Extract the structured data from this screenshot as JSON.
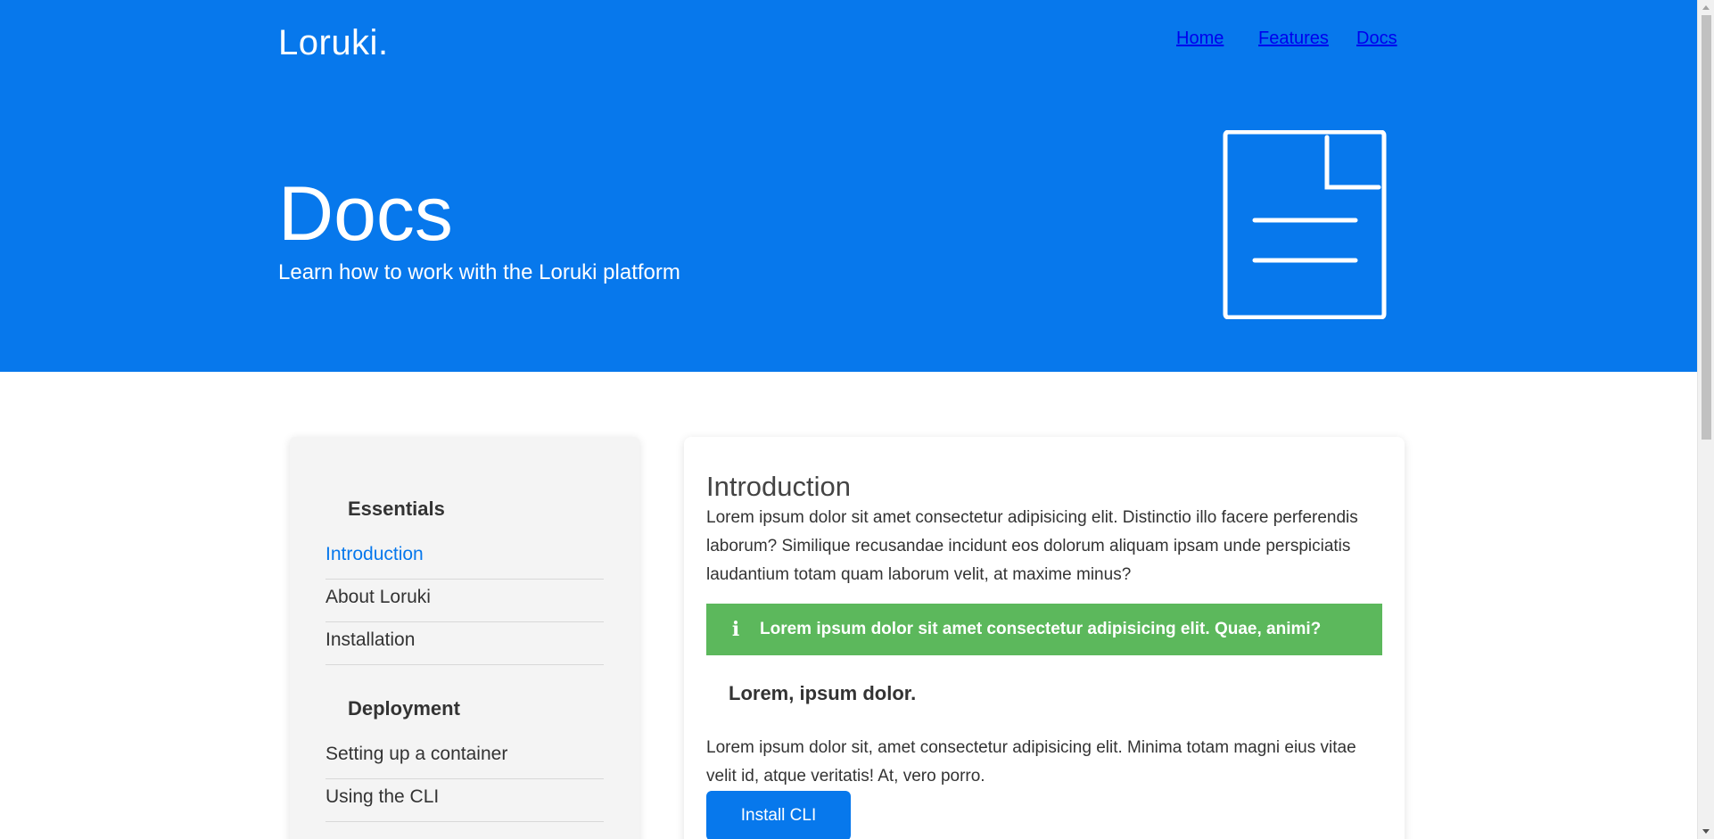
{
  "header": {
    "brand": "Loruki.",
    "nav": [
      "Home",
      "Features",
      "Docs"
    ],
    "title": "Docs",
    "subtitle": "Learn how to work with the Loruki platform",
    "hero_icon": "document-icon"
  },
  "colors": {
    "primary": "#0778ec",
    "alert_success": "#5cb85c",
    "sidebar_bg": "#f4f4f4"
  },
  "sidebar": {
    "sections": [
      {
        "heading": "Essentials",
        "links": [
          "Introduction",
          "About Loruki",
          "Installation"
        ]
      },
      {
        "heading": "Deployment",
        "links": [
          "Setting up a container",
          "Using the CLI"
        ]
      }
    ],
    "active_link": "Introduction"
  },
  "content": {
    "title": "Introduction",
    "paragraph1": "Lorem ipsum dolor sit amet consectetur adipisicing elit. Distinctio illo facere perferendis laborum? Similique recusandae incidunt eos dolorum aliquam ipsam unde perspiciatis laudantium totam quam laborum velit, at maxime minus?",
    "alert": {
      "icon": "info-icon",
      "text": "Lorem ipsum dolor sit amet consectetur adipisicing elit. Quae, animi?"
    },
    "subheading": "Lorem, ipsum dolor.",
    "paragraph2": "Lorem ipsum dolor sit, amet consectetur adipisicing elit. Minima totam magni eius vitae velit id, atque veritatis! At, vero porro.",
    "button": "Install CLI"
  }
}
